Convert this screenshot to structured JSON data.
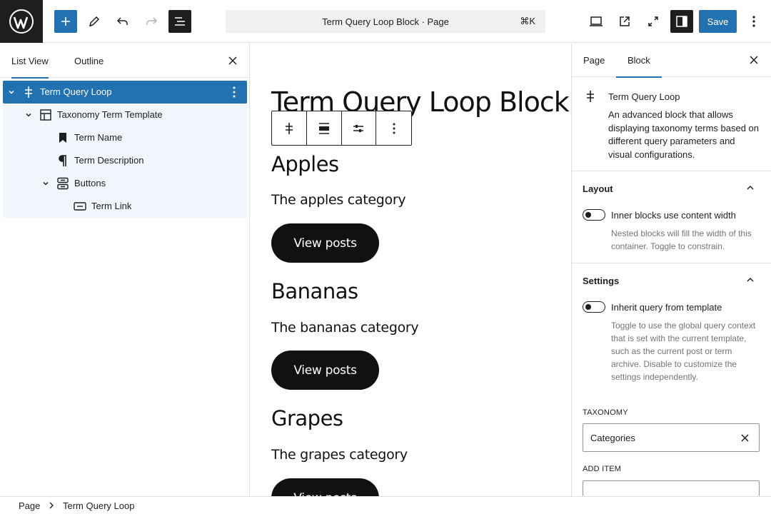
{
  "header": {
    "command_palette_label": "Term Query Loop Block · Page",
    "shortcut": "⌘K",
    "save_label": "Save",
    "accent_color": "#2271b1"
  },
  "left_panel": {
    "tabs": [
      {
        "label": "List View",
        "active": true
      },
      {
        "label": "Outline",
        "active": false
      }
    ],
    "tree": [
      {
        "label": "Term Query Loop",
        "icon": "query-loop-icon",
        "expanded": true,
        "selected": true
      },
      {
        "label": "Taxonomy Term Template",
        "icon": "template-layout-icon",
        "expanded": true
      },
      {
        "label": "Term Name",
        "icon": "bookmark-icon"
      },
      {
        "label": "Term Description",
        "icon": "pilcrow-icon"
      },
      {
        "label": "Buttons",
        "icon": "buttons-icon",
        "expanded": true
      },
      {
        "label": "Term Link",
        "icon": "button-link-icon"
      }
    ]
  },
  "canvas": {
    "title": "Term Query Loop Block",
    "terms": [
      {
        "name": "Apples",
        "description": "The apples category",
        "button": "View posts"
      },
      {
        "name": "Bananas",
        "description": "The bananas category",
        "button": "View posts"
      },
      {
        "name": "Grapes",
        "description": "The grapes category",
        "button": "View posts"
      }
    ]
  },
  "right_panel": {
    "tabs": [
      {
        "label": "Page",
        "active": false
      },
      {
        "label": "Block",
        "active": true
      }
    ],
    "block": {
      "name": "Term Query Loop",
      "description": "An advanced block that allows displaying taxonomy terms based on different query parameters and visual configurations."
    },
    "layout": {
      "title": "Layout",
      "toggle_label": "Inner blocks use content width",
      "toggle_on": false,
      "help": "Nested blocks will fill the width of this container. Toggle to constrain."
    },
    "settings": {
      "title": "Settings",
      "toggle_label": "Inherit query from template",
      "toggle_on": false,
      "help": "Toggle to use the global query context that is set with the current template, such as the current post or term archive. Disable to customize the settings independently.",
      "taxonomy_label": "TAXONOMY",
      "taxonomy_value": "Categories",
      "add_item_label": "ADD ITEM"
    }
  },
  "breadcrumb": [
    "Page",
    "Term Query Loop"
  ]
}
